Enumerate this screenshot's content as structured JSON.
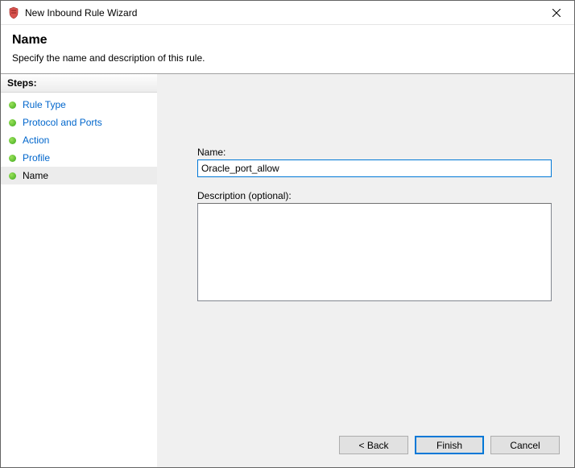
{
  "window": {
    "title": "New Inbound Rule Wizard"
  },
  "header": {
    "title": "Name",
    "subtitle": "Specify the name and description of this rule."
  },
  "sidebar": {
    "heading": "Steps:",
    "items": [
      {
        "label": "Rule Type"
      },
      {
        "label": "Protocol and Ports"
      },
      {
        "label": "Action"
      },
      {
        "label": "Profile"
      },
      {
        "label": "Name"
      }
    ],
    "currentIndex": 4
  },
  "form": {
    "nameLabel": "Name:",
    "nameValue": "Oracle_port_allow",
    "descLabel": "Description (optional):",
    "descValue": ""
  },
  "buttons": {
    "back": "< Back",
    "primary": "Finish",
    "cancel": "Cancel"
  }
}
